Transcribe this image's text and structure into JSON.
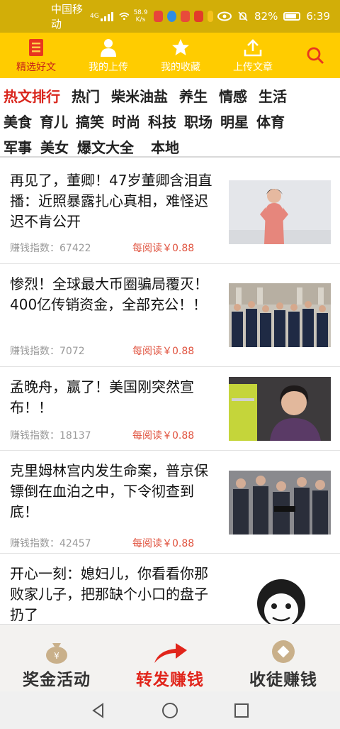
{
  "status_bar": {
    "carrier": "中国移动",
    "network": "4G",
    "speed_value": "58.9",
    "speed_unit": "K/s",
    "battery": "82%",
    "time": "6:39"
  },
  "top_nav": {
    "tabs": [
      {
        "label": "精选好文",
        "icon": "document-list-icon",
        "active": true
      },
      {
        "label": "我的上传",
        "icon": "user-icon",
        "active": false
      },
      {
        "label": "我的收藏",
        "icon": "star-icon",
        "active": false
      },
      {
        "label": "上传文章",
        "icon": "upload-icon",
        "active": false
      }
    ],
    "search_icon": "search-icon"
  },
  "categories": {
    "rows": [
      [
        "热文排行",
        "热门",
        "柴米油盐",
        "养生",
        "情感",
        "生活"
      ],
      [
        "美食",
        "育儿",
        "搞笑",
        "时尚",
        "科技",
        "职场",
        "明星",
        "体育"
      ],
      [
        "军事",
        "美女",
        "爆文大全",
        "本地"
      ]
    ],
    "highlight": "热文排行"
  },
  "articles": [
    {
      "title": "再见了，董卿！47岁董卿含泪直播：近照暴露扎心真相，难怪迟迟不肯公开",
      "index_label": "赚钱指数：",
      "index": "67422",
      "reward": "每阅读￥0.88"
    },
    {
      "title": "惨烈！全球最大币圈骗局覆灭！400亿传销资金，全部充公！！",
      "index_label": "赚钱指数：",
      "index": "7072",
      "reward": "每阅读￥0.88"
    },
    {
      "title": "孟晚舟，赢了！美国刚突然宣布！！",
      "index_label": "赚钱指数：",
      "index": "18137",
      "reward": "每阅读￥0.88"
    },
    {
      "title": "克里姆林宫内发生命案，普京保镖倒在血泊之中，下令彻查到底！",
      "index_label": "赚钱指数：",
      "index": "42457",
      "reward": "每阅读￥0.88"
    },
    {
      "title": "开心一刻：媳妇儿，你看看你那败家儿子，把那缺个小口的盘子扔了",
      "index_label": "",
      "index": "",
      "reward": ""
    }
  ],
  "bottom_bar": [
    {
      "label": "奖金活动",
      "icon": "money-bag-icon"
    },
    {
      "label": "转发赚钱",
      "icon": "share-arrow-icon"
    },
    {
      "label": "收徒赚钱",
      "icon": "coin-icon"
    }
  ],
  "colors": {
    "status_bar": "#d2ae08",
    "nav_bar": "#ffcc00",
    "accent_red": "#d9251c",
    "reward_text": "#e0523e"
  }
}
